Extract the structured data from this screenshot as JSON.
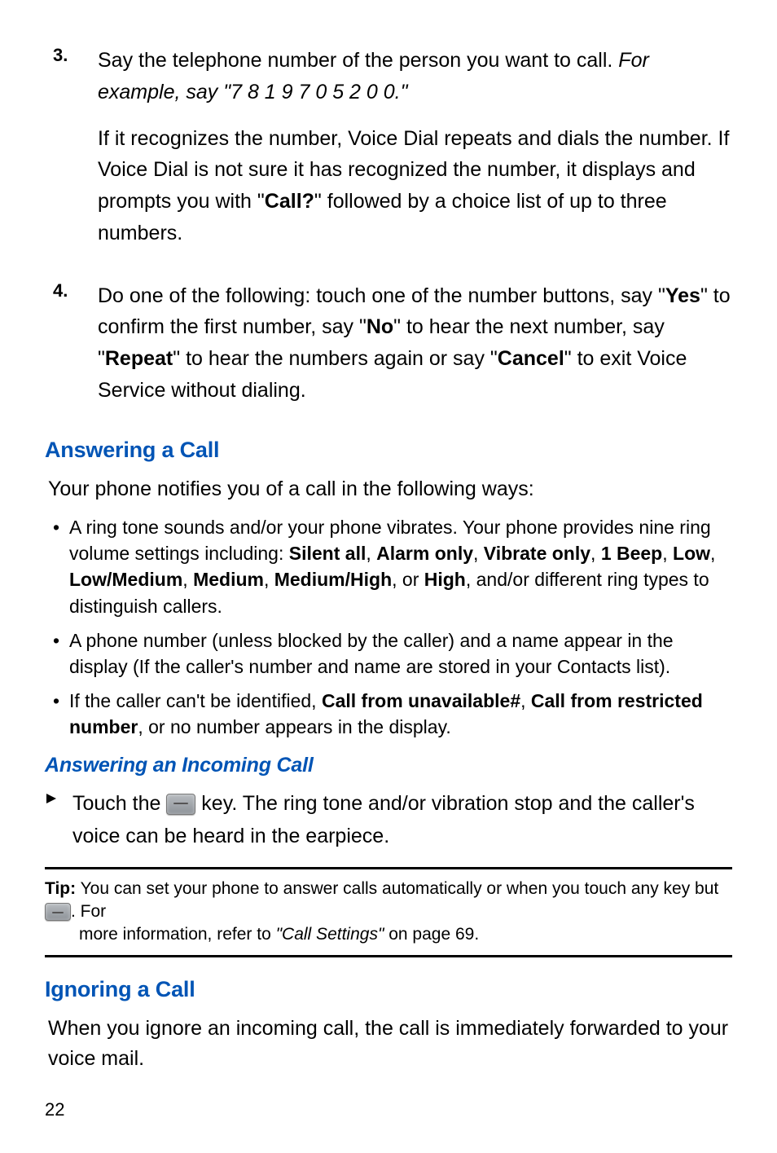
{
  "step3": {
    "num": "3.",
    "line1_a": "Say the telephone number of the person you want to call. ",
    "line1_b": "For example, say \"7 8 1 9 7 0 5 2 0 0.\"",
    "para2_a": "If it recognizes the number, Voice Dial repeats and dials the number. If Voice Dial is not sure it has recognized the number, it displays and prompts you with \"",
    "para2_b": "Call?",
    "para2_c": "\" followed by a choice list of up to three numbers."
  },
  "step4": {
    "num": "4.",
    "a": "Do one of the following: touch one of the number buttons, say \"",
    "yes": "Yes",
    "b": "\" to confirm the first number, say \"",
    "no": "No",
    "c": "\" to hear the next number, say \"",
    "repeat": "Repeat",
    "d": "\" to hear the numbers again or say \"",
    "cancel": "Cancel",
    "e": "\" to exit Voice Service without dialing."
  },
  "answering": {
    "head": "Answering a Call",
    "intro": "Your phone notifies you of a call in the following ways:",
    "b1_a": "A ring tone sounds and/or your phone vibrates. Your phone provides nine ring volume settings including: ",
    "b1_s1": "Silent all",
    "b1_c1": ", ",
    "b1_s2": "Alarm only",
    "b1_c2": ", ",
    "b1_s3": "Vibrate only",
    "b1_c3": ", ",
    "b1_s4": "1 Beep",
    "b1_c4": ", ",
    "b1_s5": "Low",
    "b1_c5": ", ",
    "b1_s6": "Low/Medium",
    "b1_c6": ", ",
    "b1_s7": "Medium",
    "b1_c7": ", ",
    "b1_s8": "Medium/High",
    "b1_c8": ", or ",
    "b1_s9": "High",
    "b1_tail": ", and/or different ring types to distinguish callers.",
    "b2": "A phone number (unless blocked by the caller) and a name appear in the display (If the caller's number and name are stored in your Contacts list).",
    "b3_a": "If the caller can't be identified, ",
    "b3_s1": "Call from unavailable#",
    "b3_c1": ", ",
    "b3_s2": "Call from restricted number",
    "b3_tail": ", or no number appears in the display."
  },
  "incoming": {
    "head": "Answering an Incoming Call",
    "a": "Touch the ",
    "b": " key. The ring tone and/or vibration stop and the caller's voice can be heard in the earpiece."
  },
  "tip": {
    "label": "Tip:",
    "a": " You can set your phone to answer calls automatically or when you touch any key but ",
    "b": ". For",
    "c": "more information, refer to ",
    "ref": "\"Call Settings\"",
    "d": "  on page 69."
  },
  "ignoring": {
    "head": "Ignoring a Call",
    "body": "When you ignore an incoming call, the call is immediately forwarded to your voice mail."
  },
  "pageNum": "22"
}
